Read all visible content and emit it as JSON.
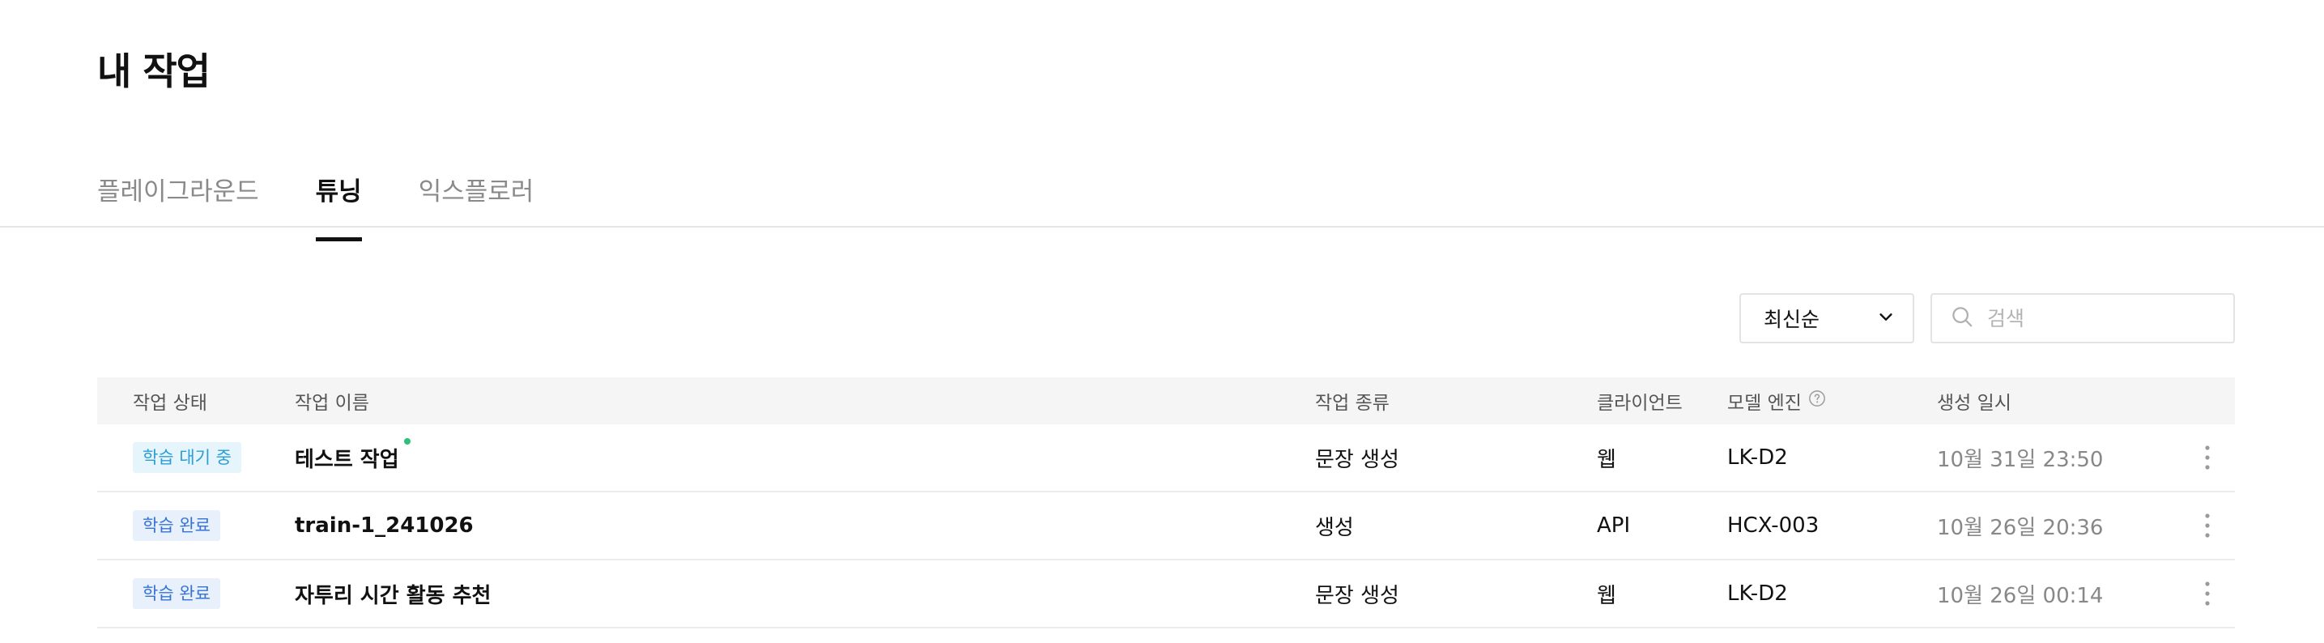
{
  "page": {
    "title": "내 작업"
  },
  "tabs": [
    {
      "label": "플레이그라운드",
      "active": false
    },
    {
      "label": "튜닝",
      "active": true
    },
    {
      "label": "익스플로러",
      "active": false
    }
  ],
  "toolbar": {
    "sort_value": "최신순",
    "search_placeholder": "검색"
  },
  "table": {
    "headers": {
      "status": "작업 상태",
      "name": "작업 이름",
      "type": "작업 종류",
      "client": "클라이언트",
      "engine": "모델 엔진",
      "created": "생성 일시"
    },
    "rows": [
      {
        "status": "학습 대기 중",
        "status_kind": "waiting",
        "name": "테스트 작업",
        "is_new": true,
        "type": "문장 생성",
        "client": "웹",
        "engine": "LK-D2",
        "created": "10월 31일 23:50"
      },
      {
        "status": "학습 완료",
        "status_kind": "done",
        "name": "train-1_241026",
        "is_new": false,
        "type": "생성",
        "client": "API",
        "engine": "HCX-003",
        "created": "10월 26일 20:36"
      },
      {
        "status": "학습 완료",
        "status_kind": "done",
        "name": "자투리 시간 활동 추천",
        "is_new": false,
        "type": "문장 생성",
        "client": "웹",
        "engine": "LK-D2",
        "created": "10월 26일 00:14"
      }
    ]
  },
  "colors": {
    "new_dot": "#2ec07a",
    "waiting_badge_text": "#2b9dd6",
    "done_badge_text": "#3673d6"
  }
}
